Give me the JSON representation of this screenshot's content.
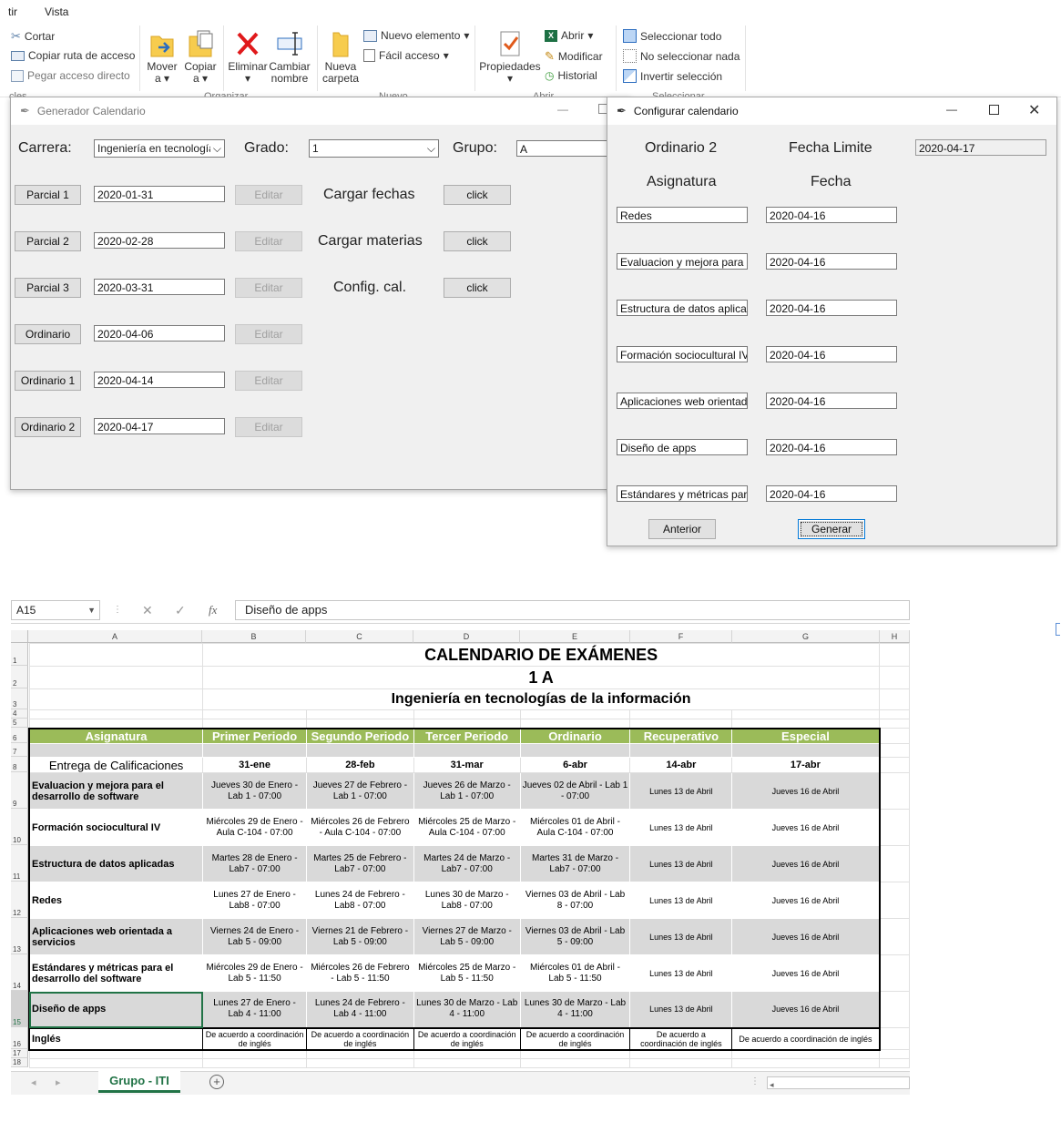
{
  "ribbon": {
    "menu": [
      "tir",
      "Vista"
    ],
    "clipboard": {
      "cut": "Cortar",
      "copy_path": "Copiar ruta de acceso",
      "paste_shortcut": "Pegar acceso directo",
      "group": "cles"
    },
    "organize": {
      "move": "Mover",
      "move2": "a",
      "copy": "Copiar",
      "copy2": "a",
      "delete": "Eliminar",
      "rename": "Cambiar",
      "rename2": "nombre",
      "group": "Organizar"
    },
    "new": {
      "new_folder": "Nueva",
      "new_folder2": "carpeta",
      "new_item": "Nuevo elemento",
      "easy_access": "Fácil acceso",
      "group": "Nuevo"
    },
    "open": {
      "properties": "Propiedades",
      "open": "Abrir",
      "edit": "Modificar",
      "history": "Historial",
      "group": "Abrir"
    },
    "select": {
      "select_all": "Seleccionar todo",
      "select_none": "No seleccionar nada",
      "invert": "Invertir selección",
      "group": "Seleccionar"
    }
  },
  "gen_window": {
    "title": "Generador Calendario",
    "carrera_label": "Carrera:",
    "carrera_value": "Ingeniería en tecnologías",
    "grado_label": "Grado:",
    "grado_value": "1",
    "grupo_label": "Grupo:",
    "grupo_value": "A",
    "rows": [
      {
        "button": "Parcial 1",
        "date": "2020-01-31",
        "edit": "Editar"
      },
      {
        "button": "Parcial 2",
        "date": "2020-02-28",
        "edit": "Editar"
      },
      {
        "button": "Parcial 3",
        "date": "2020-03-31",
        "edit": "Editar"
      },
      {
        "button": "Ordinario",
        "date": "2020-04-06",
        "edit": "Editar"
      },
      {
        "button": "Ordinario 1",
        "date": "2020-04-14",
        "edit": "Editar"
      },
      {
        "button": "Ordinario 2",
        "date": "2020-04-17",
        "edit": "Editar"
      }
    ],
    "actions": [
      {
        "label": "Cargar fechas",
        "button": "click"
      },
      {
        "label": "Cargar materias",
        "button": "click"
      },
      {
        "label": "Config. cal.",
        "button": "click"
      }
    ]
  },
  "config_window": {
    "title": "Configurar calendario",
    "ordinario_label": "Ordinario 2",
    "fecha_limite_label": "Fecha Limite",
    "fecha_limite_value": "2020-04-17",
    "asignatura_header": "Asignatura",
    "fecha_header": "Fecha",
    "rows": [
      {
        "subject": "Redes",
        "date": "2020-04-16"
      },
      {
        "subject": "Evaluacion y mejora para el",
        "date": "2020-04-16"
      },
      {
        "subject": "Estructura de datos aplicadas",
        "date": "2020-04-16"
      },
      {
        "subject": "Formación sociocultural IV",
        "date": "2020-04-16"
      },
      {
        "subject": "Aplicaciones web orientadas",
        "date": "2020-04-16"
      },
      {
        "subject": "Diseño de apps",
        "date": "2020-04-16"
      },
      {
        "subject": "Estándares y métricas para",
        "date": "2020-04-16"
      }
    ],
    "prev_button": "Anterior",
    "generate_button": "Generar"
  },
  "excel": {
    "name_box": "A15",
    "formula": "Diseño de apps",
    "fx": "fx",
    "columns": [
      "A",
      "B",
      "C",
      "D",
      "E",
      "F",
      "G",
      "H"
    ],
    "row_numbers": [
      "1",
      "2",
      "3",
      "4",
      "5",
      "6",
      "7",
      "8",
      "9",
      "10",
      "11",
      "12",
      "13",
      "14",
      "15",
      "16",
      "17",
      "18"
    ],
    "title1": "CALENDARIO DE EXÁMENES",
    "title2": "1 A",
    "title3": "Ingeniería en tecnologías de la información",
    "headers": [
      "Asignatura",
      "Primer Periodo",
      "Segundo Periodo",
      "Tercer Periodo",
      "Ordinario",
      "Recuperativo",
      "Especial"
    ],
    "delivery": [
      "Entrega de Calificaciones",
      "31-ene",
      "28-feb",
      "31-mar",
      "6-abr",
      "14-abr",
      "17-abr"
    ],
    "rows": [
      [
        "Evaluacion y mejora para el desarrollo de software",
        "Jueves 30 de Enero - Lab 1 - 07:00",
        "Jueves 27 de Febrero - Lab 1 - 07:00",
        "Jueves 26 de Marzo - Lab 1 - 07:00",
        "Jueves 02 de Abril - Lab 1 - 07:00",
        "Lunes 13 de Abril",
        "Jueves 16 de Abril"
      ],
      [
        "Formación sociocultural IV",
        "Miércoles 29 de Enero - Aula C-104 - 07:00",
        "Miércoles 26 de Febrero - Aula C-104 - 07:00",
        "Miércoles 25 de Marzo - Aula C-104 - 07:00",
        "Miércoles 01 de Abril - Aula C-104 - 07:00",
        "Lunes 13 de Abril",
        "Jueves 16 de Abril"
      ],
      [
        "Estructura de datos aplicadas",
        "Martes 28 de Enero - Lab7 - 07:00",
        "Martes 25 de Febrero - Lab7 - 07:00",
        "Martes 24 de Marzo - Lab7 - 07:00",
        "Martes 31 de Marzo - Lab7 - 07:00",
        "Lunes 13 de Abril",
        "Jueves 16 de Abril"
      ],
      [
        "Redes",
        "Lunes 27 de Enero - Lab8 - 07:00",
        "Lunes 24 de Febrero - Lab8 - 07:00",
        "Lunes 30 de Marzo - Lab8 - 07:00",
        "Viernes 03 de Abril - Lab 8 - 07:00",
        "Lunes 13 de Abril",
        "Jueves 16 de Abril"
      ],
      [
        "Aplicaciones web orientada a servicios",
        "Viernes 24 de Enero - Lab 5 - 09:00",
        "Viernes 21 de Febrero - Lab 5 - 09:00",
        "Viernes 27 de Marzo - Lab 5 - 09:00",
        "Viernes 03 de Abril - Lab 5 - 09:00",
        "Lunes 13 de Abril",
        "Jueves 16 de Abril"
      ],
      [
        "Estándares y métricas para el desarrollo del software",
        "Miércoles 29 de Enero - Lab 5 - 11:50",
        "Miércoles 26 de Febrero - Lab 5 - 11:50",
        "Miércoles 25 de Marzo - Lab 5 - 11:50",
        "Miércoles 01 de Abril - Lab 5 - 11:50",
        "Lunes 13 de Abril",
        "Jueves 16 de Abril"
      ],
      [
        "Diseño de apps",
        "Lunes 27 de Enero - Lab 4 - 11:00",
        "Lunes 24 de Febrero - Lab 4 - 11:00",
        "Lunes 30 de Marzo - Lab 4 - 11:00",
        "Lunes 30 de Marzo - Lab 4 - 11:00",
        "Lunes 13 de Abril",
        "Jueves 16 de Abril"
      ],
      [
        "Inglés",
        "De acuerdo a coordinación de inglés",
        "De acuerdo a coordinación de inglés",
        "De acuerdo a coordinación de inglés",
        "De acuerdo a coordinación de inglés",
        "De acuerdo a coordinación de inglés",
        "De acuerdo a coordinación de inglés"
      ]
    ],
    "sheet_tab": "Grupo - ITI",
    "colors": {
      "header_green": "#9bbb59",
      "band_gray": "#d9d9d9",
      "tab_green": "#217346"
    }
  }
}
